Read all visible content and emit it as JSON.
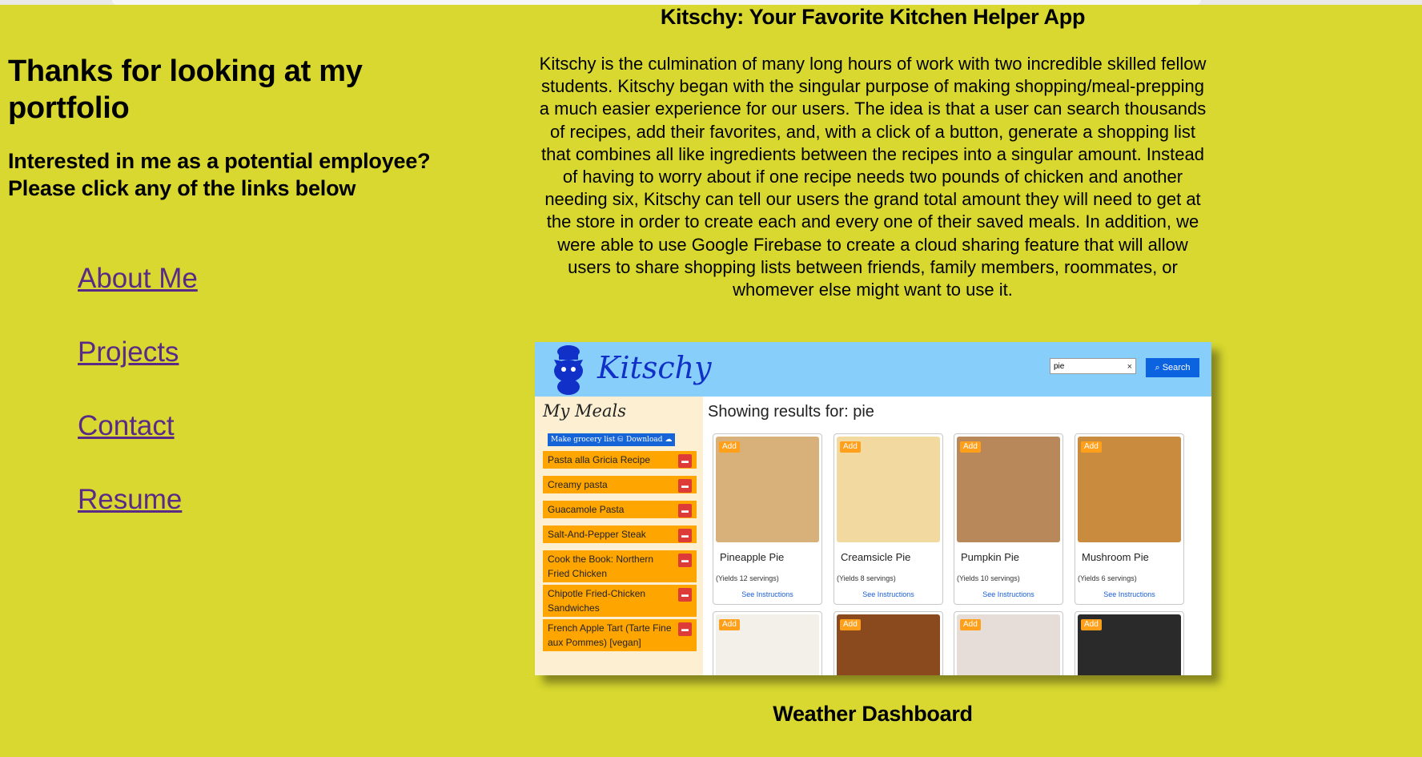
{
  "left": {
    "heading": "Thanks for looking at my portfolio",
    "subheading": "Interested in me as a potential employee? Please click any of the links below",
    "links": [
      {
        "label": "About Me"
      },
      {
        "label": "Projects"
      },
      {
        "label": "Contact"
      },
      {
        "label": "Resume"
      }
    ]
  },
  "project": {
    "title": "Kitschy: Your Favorite Kitchen Helper App",
    "description": "Kitschy is the culmination of many long hours of work with two incredible skilled fellow students. Kitschy began with the singular purpose of making shopping/meal-prepping a much easier experience for our users. The idea is that a user can search thousands of recipes, add their favorites, and, with a click of a button, generate a shopping list that combines all like ingredients between the recipes into a singular amount. Instead of having to worry about if one recipe needs two pounds of chicken and another needing six, Kitschy can tell our users the grand total amount they will need to get at the store in order to create each and every one of their saved meals. In addition, we were able to use Google Firebase to create a cloud sharing feature that will allow users to share shopping lists between friends, family members, roommates, or whomever else might want to use it."
  },
  "screenshot": {
    "logo": "Kitschy",
    "search_value": "pie",
    "search_clear": "×",
    "search_button": "Search",
    "sidebar_title": "My Meals",
    "grocery_button": "Make grocery list",
    "download_button": "Download",
    "meals": [
      "Pasta alla Gricia Recipe",
      "Creamy pasta",
      "Guacamole Pasta",
      "Salt-And-Pepper Steak",
      "Cook the Book: Northern Fried Chicken",
      "Chipotle Fried-Chicken Sandwiches",
      "French Apple Tart (Tarte Fine aux Pommes) [vegan]"
    ],
    "results_label": "Showing results for: pie",
    "add_label": "Add",
    "recipes": [
      {
        "name": "Pineapple Pie",
        "yield": "(Yields 12 servings)",
        "link": "See Instructions",
        "color": "#d8b07a"
      },
      {
        "name": "Creamsicle Pie",
        "yield": "(Yields 8 servings)",
        "link": "See Instructions",
        "color": "#f2d9a0"
      },
      {
        "name": "Pumpkin Pie",
        "yield": "(Yields 10 servings)",
        "link": "See Instructions",
        "color": "#b8875a"
      },
      {
        "name": "Mushroom Pie",
        "yield": "(Yields 6 servings)",
        "link": "See Instructions",
        "color": "#c98b3e"
      },
      {
        "color": "#f3f0ea"
      },
      {
        "color": "#8a4a1e"
      },
      {
        "color": "#e6dcd8"
      },
      {
        "color": "#2a2a2a"
      }
    ]
  },
  "next_project": {
    "title": "Weather Dashboard"
  },
  "colors": {
    "page_bg": "#d8d830",
    "link": "#5a2a86",
    "header_bg": "#87cefa",
    "meal_bg": "#ffa500",
    "button_blue": "#0b63e0"
  }
}
